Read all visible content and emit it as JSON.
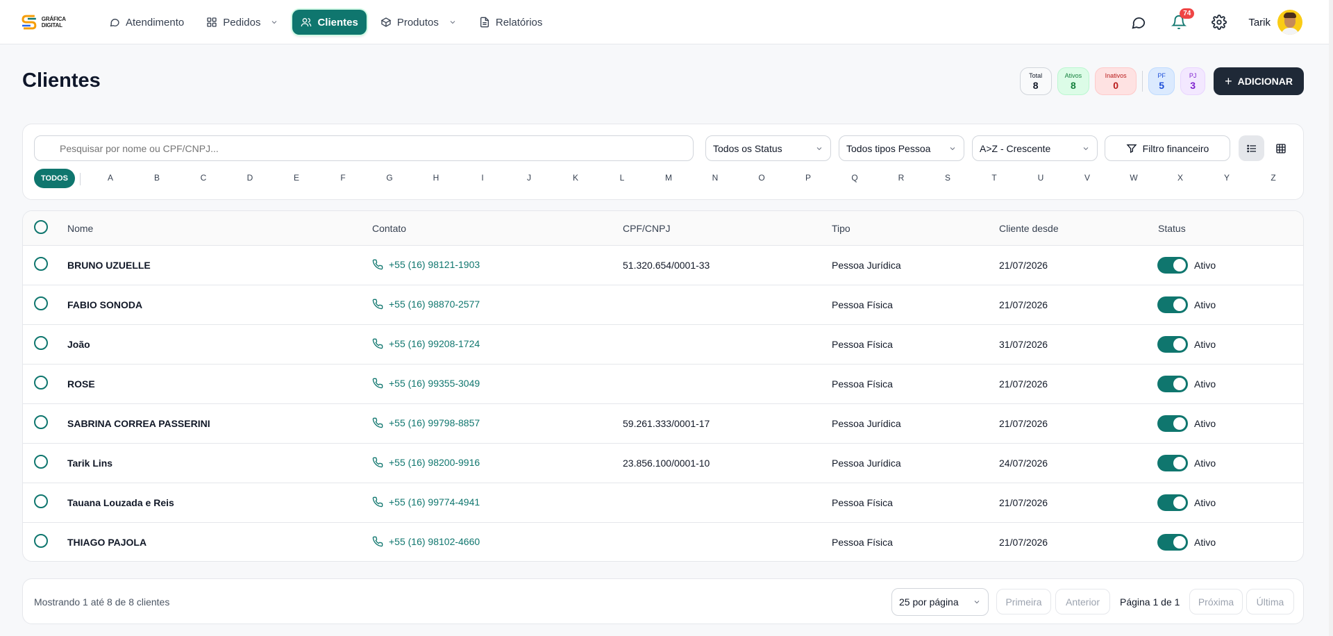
{
  "app": {
    "logo_text": "GRÁFICA DIGITAL"
  },
  "nav": [
    {
      "label": "Atendimento",
      "icon": "chat-icon",
      "dropdown": false,
      "active": false
    },
    {
      "label": "Pedidos",
      "icon": "grid-icon",
      "dropdown": true,
      "active": false
    },
    {
      "label": "Clientes",
      "icon": "users-icon",
      "dropdown": false,
      "active": true
    },
    {
      "label": "Produtos",
      "icon": "box-icon",
      "dropdown": true,
      "active": false
    },
    {
      "label": "Relatórios",
      "icon": "document-icon",
      "dropdown": false,
      "active": false
    }
  ],
  "header_tools": {
    "notifications_count": "74",
    "user_name": "Tarik"
  },
  "page": {
    "title": "Clientes",
    "add_label": "ADICIONAR"
  },
  "stats": [
    {
      "label": "Total",
      "value": "8",
      "kind": "total"
    },
    {
      "label": "Ativos",
      "value": "8",
      "kind": "ativos"
    },
    {
      "label": "Inativos",
      "value": "0",
      "kind": "inativos"
    },
    {
      "label": "PF",
      "value": "5",
      "kind": "pf"
    },
    {
      "label": "PJ",
      "value": "3",
      "kind": "pj"
    }
  ],
  "filters": {
    "search_placeholder": "Pesquisar por nome ou CPF/CNPJ...",
    "status_select": "Todos os Status",
    "pessoa_select": "Todos tipos Pessoa",
    "sort_select": "A>Z - Crescente",
    "financial_label": "Filtro financeiro",
    "todos_label": "TODOS",
    "letters": [
      "A",
      "B",
      "C",
      "D",
      "E",
      "F",
      "G",
      "H",
      "I",
      "J",
      "K",
      "L",
      "M",
      "N",
      "O",
      "P",
      "Q",
      "R",
      "S",
      "T",
      "U",
      "V",
      "W",
      "X",
      "Y",
      "Z"
    ]
  },
  "table": {
    "columns": [
      "Nome",
      "Contato",
      "CPF/CNPJ",
      "Tipo",
      "Cliente desde",
      "Status"
    ],
    "rows": [
      {
        "nome": "BRUNO UZUELLE",
        "contato": "+55 (16) 98121-1903",
        "doc": "51.320.654/0001-33",
        "tipo": "Pessoa Jurídica",
        "desde": "21/07/2026",
        "status": "Ativo"
      },
      {
        "nome": "FABIO SONODA",
        "contato": "+55 (16) 98870-2577",
        "doc": "",
        "tipo": "Pessoa Física",
        "desde": "21/07/2026",
        "status": "Ativo"
      },
      {
        "nome": "João",
        "contato": "+55 (16) 99208-1724",
        "doc": "",
        "tipo": "Pessoa Física",
        "desde": "31/07/2026",
        "status": "Ativo"
      },
      {
        "nome": "ROSE",
        "contato": "+55 (16) 99355-3049",
        "doc": "",
        "tipo": "Pessoa Física",
        "desde": "21/07/2026",
        "status": "Ativo"
      },
      {
        "nome": "SABRINA CORREA PASSERINI",
        "contato": "+55 (16) 99798-8857",
        "doc": "59.261.333/0001-17",
        "tipo": "Pessoa Jurídica",
        "desde": "21/07/2026",
        "status": "Ativo"
      },
      {
        "nome": "Tarik Lins",
        "contato": "+55 (16) 98200-9916",
        "doc": "23.856.100/0001-10",
        "tipo": "Pessoa Jurídica",
        "desde": "24/07/2026",
        "status": "Ativo"
      },
      {
        "nome": "Tauana Louzada e Reis",
        "contato": "+55 (16) 99774-4941",
        "doc": "",
        "tipo": "Pessoa Física",
        "desde": "21/07/2026",
        "status": "Ativo"
      },
      {
        "nome": "THIAGO PAJOLA",
        "contato": "+55 (16) 98102-4660",
        "doc": "",
        "tipo": "Pessoa Física",
        "desde": "21/07/2026",
        "status": "Ativo"
      }
    ]
  },
  "pagination": {
    "showing": "Mostrando 1 até 8 de 8 clientes",
    "per_page": "25 por página",
    "first": "Primeira",
    "prev": "Anterior",
    "page_label": "Página 1 de 1",
    "next": "Próxima",
    "last": "Última"
  },
  "colors": {
    "accent": "#0f766e",
    "dark_button": "#1f2937",
    "badge": "#ef4444"
  }
}
